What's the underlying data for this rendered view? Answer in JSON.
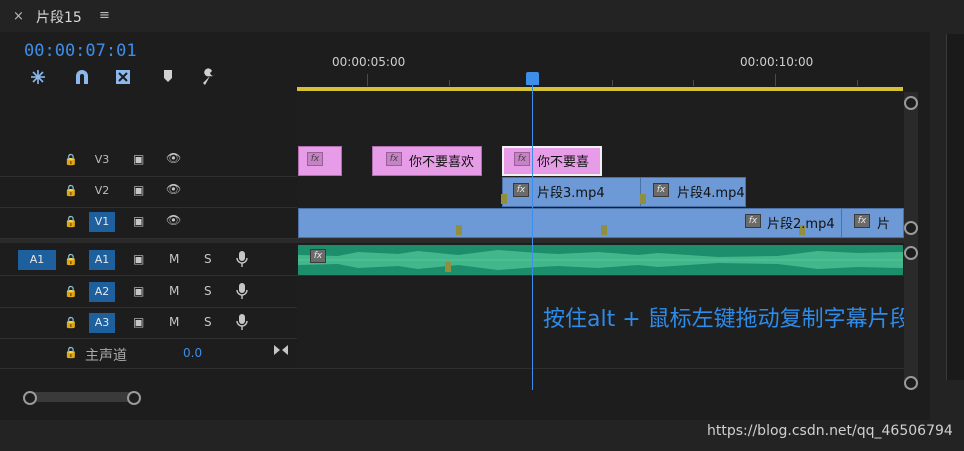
{
  "tab": {
    "title": "片段15",
    "close_glyph": "×",
    "menu_glyph": "≡"
  },
  "timecode": "00:00:07:01",
  "tools": [
    "snap-icon",
    "magnet-icon",
    "linked-selection-icon",
    "marker-icon",
    "wrench-icon"
  ],
  "ruler": {
    "labels": [
      "00:00:05:00",
      "00:00:10:00"
    ]
  },
  "tracks": {
    "v3": {
      "label": "V3"
    },
    "v2": {
      "label": "V2"
    },
    "v1": {
      "label": "V1",
      "source": ""
    },
    "a1": {
      "label": "A1",
      "source": "A1",
      "m": "M",
      "s": "S"
    },
    "a2": {
      "label": "A2",
      "m": "M",
      "s": "S"
    },
    "a3": {
      "label": "A3",
      "m": "M",
      "s": "S"
    },
    "master": {
      "label": "主声道",
      "value": "0.0"
    }
  },
  "clips": {
    "v3": [
      {
        "text": ""
      },
      {
        "text": "你不要喜欢"
      },
      {
        "text": "你不要喜"
      }
    ],
    "v2": [
      {
        "text": "片段3.mp4"
      },
      {
        "text": "片段4.mp4"
      }
    ],
    "v1": [
      {
        "text": "片段2.mp4"
      },
      {
        "text": "片"
      }
    ]
  },
  "fx_label": "fx",
  "annotation": "按住alt + 鼠标左键拖动复制字幕片段",
  "watermark": "https://blog.csdn.net/qq_46506794",
  "colors": {
    "accent": "#3d8ee8",
    "pink_clip": "#e79ce7",
    "video_clip": "#6d9ad6",
    "audio_clip": "#1d8e6b",
    "work_area": "#d6c232"
  }
}
